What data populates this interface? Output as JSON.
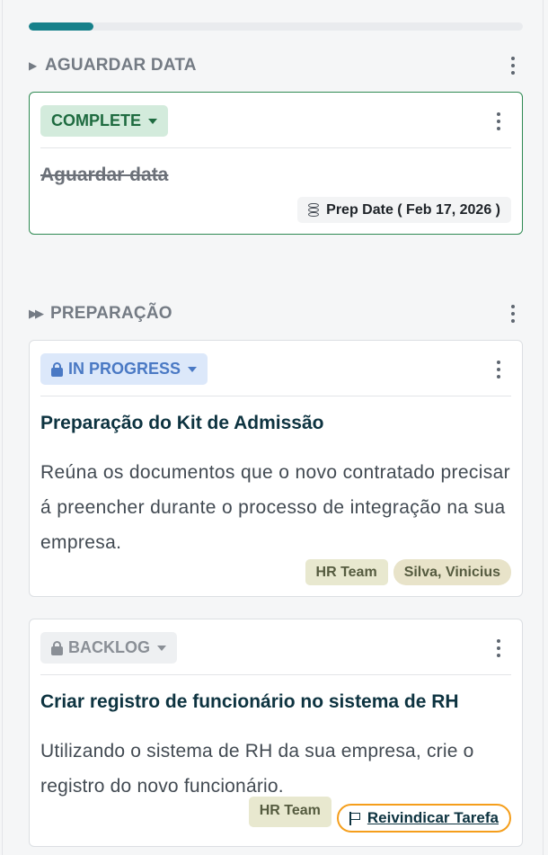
{
  "progress": {
    "percent": 13,
    "color": "#16808a"
  },
  "sections": [
    {
      "title": "AGUARDAR DATA",
      "icon": "caret-right-icon"
    },
    {
      "title": "PREPARAÇÃO",
      "icon": "fast-forward-icon"
    }
  ],
  "cards": [
    {
      "status": "COMPLETE",
      "status_color": "#1e6b40",
      "status_bg": "#d3ebdc",
      "title": "Aguardar data",
      "date_label": "Prep Date ( Feb 17, 2026 )"
    },
    {
      "status": "IN PROGRESS",
      "status_color": "#4a79c4",
      "status_bg": "#dce8fa",
      "title": "Preparação do Kit de Admissão",
      "description": "Reúna os documentos que o novo contratado precisará preencher durante o processo de integração na sua empresa.",
      "tags": [
        "HR Team",
        "Silva, Vinicius"
      ]
    },
    {
      "status": "BACKLOG",
      "status_color": "#8a8f96",
      "status_bg": "#eef0f2",
      "title": "Criar registro de funcionário no sistema de RH",
      "description": "Utilizando o sistema de RH da sua empresa, crie o registro do novo funcionário.",
      "tags": [
        "HR Team"
      ],
      "claim_label": "Reivindicar Tarefa"
    }
  ]
}
